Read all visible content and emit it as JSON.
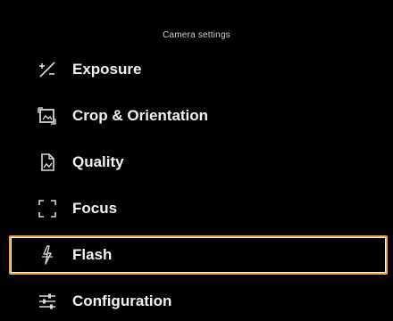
{
  "header": {
    "title": "Camera settings"
  },
  "menu": {
    "items": [
      {
        "label": "Exposure",
        "icon": "exposure-icon",
        "selected": false
      },
      {
        "label": "Crop & Orientation",
        "icon": "crop-icon",
        "selected": false
      },
      {
        "label": "Quality",
        "icon": "quality-icon",
        "selected": false
      },
      {
        "label": "Focus",
        "icon": "focus-icon",
        "selected": false
      },
      {
        "label": "Flash",
        "icon": "flash-icon",
        "selected": true
      },
      {
        "label": "Configuration",
        "icon": "configuration-icon",
        "selected": false
      }
    ]
  },
  "colors": {
    "background": "#000000",
    "text": "#f2f2f2",
    "selection_outer": "#f0a24a",
    "selection_inner": "#ffffff"
  }
}
